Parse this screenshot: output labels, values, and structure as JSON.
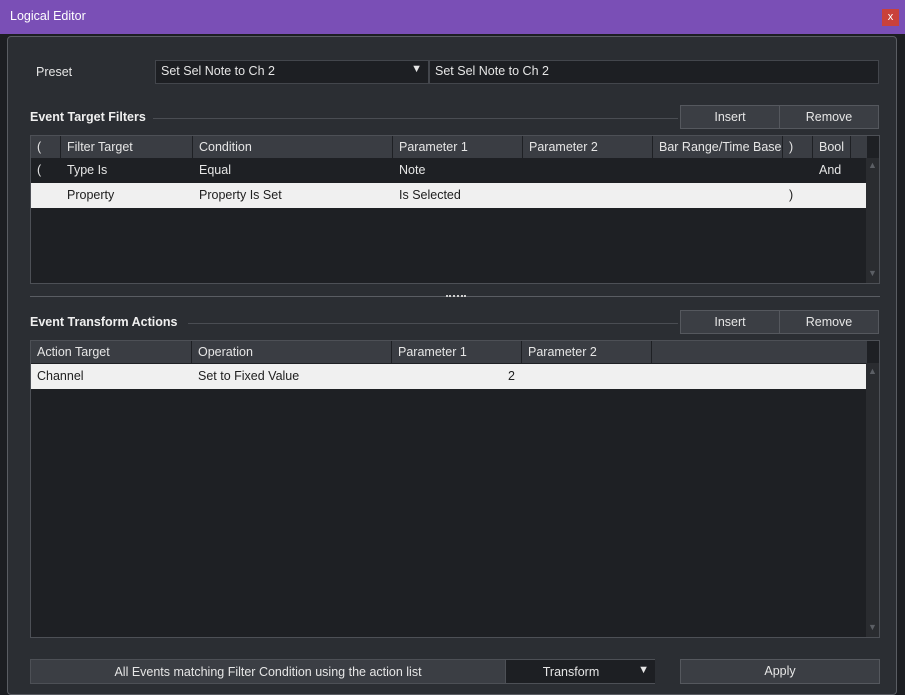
{
  "window": {
    "title": "Logical Editor",
    "close_label": "x"
  },
  "preset": {
    "label": "Preset",
    "selected": "Set Sel Note to Ch 2",
    "name_value": "Set Sel Note to Ch 2",
    "arrow": "▼"
  },
  "filters": {
    "title": "Event Target Filters",
    "insert_label": "Insert",
    "remove_label": "Remove",
    "columns": [
      "(",
      "Filter Target",
      "Condition",
      "Parameter 1",
      "Parameter 2",
      "Bar Range/Time Base",
      ")",
      "Bool"
    ],
    "rows": [
      {
        "open": "(",
        "target": "Type Is",
        "condition": "Equal",
        "param1": "Note",
        "param2": "",
        "range": "",
        "close": "",
        "bool": "And"
      },
      {
        "open": "",
        "target": "Property",
        "condition": "Property Is Set",
        "param1": "Is Selected",
        "param2": "",
        "range": "",
        "close": ")",
        "bool": ""
      }
    ]
  },
  "actions": {
    "title": "Event Transform Actions",
    "insert_label": "Insert",
    "remove_label": "Remove",
    "columns": [
      "Action Target",
      "Operation",
      "Parameter 1",
      "Parameter 2"
    ],
    "rows": [
      {
        "target": "Channel",
        "operation": "Set to Fixed Value",
        "param1": "2",
        "param2": ""
      }
    ]
  },
  "footer": {
    "status_text": "All Events matching Filter Condition using the action list",
    "function_selected": "Transform",
    "arrow": "▼",
    "apply_label": "Apply"
  },
  "icons": {
    "scroll_up": "scroll-up-icon",
    "scroll_down": "scroll-down-icon"
  },
  "colors": {
    "titlebar": "#7a4fb6",
    "close": "#c9413b",
    "panel": "#2b2e33",
    "selected_row": "#f0f0f0"
  }
}
